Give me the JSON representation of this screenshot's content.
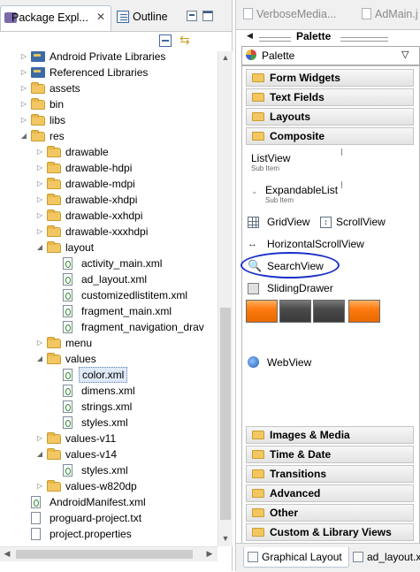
{
  "left_tabs": {
    "package_explorer": "Package Expl...",
    "outline": "Outline"
  },
  "tree": [
    {
      "label": "Android Private Libraries",
      "icon": "library",
      "indent": 0,
      "arrow": "collapsed"
    },
    {
      "label": "Referenced Libraries",
      "icon": "library",
      "indent": 0,
      "arrow": "collapsed"
    },
    {
      "label": "assets",
      "icon": "folder",
      "indent": 0,
      "arrow": "collapsed"
    },
    {
      "label": "bin",
      "icon": "folder",
      "indent": 0,
      "arrow": "collapsed"
    },
    {
      "label": "libs",
      "icon": "folder",
      "indent": 0,
      "arrow": "collapsed"
    },
    {
      "label": "res",
      "icon": "folder",
      "indent": 0,
      "arrow": "expanded"
    },
    {
      "label": "drawable",
      "icon": "folder",
      "indent": 1,
      "arrow": "collapsed"
    },
    {
      "label": "drawable-hdpi",
      "icon": "folder",
      "indent": 1,
      "arrow": "collapsed"
    },
    {
      "label": "drawable-mdpi",
      "icon": "folder",
      "indent": 1,
      "arrow": "collapsed"
    },
    {
      "label": "drawable-xhdpi",
      "icon": "folder",
      "indent": 1,
      "arrow": "collapsed"
    },
    {
      "label": "drawable-xxhdpi",
      "icon": "folder",
      "indent": 1,
      "arrow": "collapsed"
    },
    {
      "label": "drawable-xxxhdpi",
      "icon": "folder",
      "indent": 1,
      "arrow": "collapsed"
    },
    {
      "label": "layout",
      "icon": "folder",
      "indent": 1,
      "arrow": "expanded"
    },
    {
      "label": "activity_main.xml",
      "icon": "xml",
      "indent": 2,
      "arrow": "none"
    },
    {
      "label": "ad_layout.xml",
      "icon": "xml",
      "indent": 2,
      "arrow": "none"
    },
    {
      "label": "customizedlistitem.xml",
      "icon": "xml",
      "indent": 2,
      "arrow": "none"
    },
    {
      "label": "fragment_main.xml",
      "icon": "xml",
      "indent": 2,
      "arrow": "none"
    },
    {
      "label": "fragment_navigation_drav",
      "icon": "xml",
      "indent": 2,
      "arrow": "none"
    },
    {
      "label": "menu",
      "icon": "folder",
      "indent": 1,
      "arrow": "collapsed"
    },
    {
      "label": "values",
      "icon": "folder",
      "indent": 1,
      "arrow": "expanded"
    },
    {
      "label": "color.xml",
      "icon": "xml",
      "indent": 2,
      "arrow": "none",
      "selected": true
    },
    {
      "label": "dimens.xml",
      "icon": "xml",
      "indent": 2,
      "arrow": "none"
    },
    {
      "label": "strings.xml",
      "icon": "xml",
      "indent": 2,
      "arrow": "none"
    },
    {
      "label": "styles.xml",
      "icon": "xml",
      "indent": 2,
      "arrow": "none"
    },
    {
      "label": "values-v11",
      "icon": "folder",
      "indent": 1,
      "arrow": "collapsed"
    },
    {
      "label": "values-v14",
      "icon": "folder",
      "indent": 1,
      "arrow": "expanded"
    },
    {
      "label": "styles.xml",
      "icon": "xml",
      "indent": 2,
      "arrow": "none"
    },
    {
      "label": "values-w820dp",
      "icon": "folder",
      "indent": 1,
      "arrow": "collapsed"
    },
    {
      "label": "AndroidManifest.xml",
      "icon": "xml",
      "indent": 0,
      "arrow": "none"
    },
    {
      "label": "proguard-project.txt",
      "icon": "txt",
      "indent": 0,
      "arrow": "none"
    },
    {
      "label": "project.properties",
      "icon": "txt",
      "indent": 0,
      "arrow": "none"
    }
  ],
  "right_tabs": {
    "tab1": "VerboseMedia...",
    "tab2": "AdMain.j"
  },
  "palette": {
    "title": "Palette",
    "selector": "Palette",
    "categories_top": [
      "Form Widgets",
      "Text Fields",
      "Layouts",
      "Composite"
    ],
    "composite_items": {
      "listview": "ListView",
      "listview_sub": "Sub Item",
      "expandable": "ExpandableList",
      "expandable_sub": "Sub Item",
      "gridview": "GridView",
      "scrollview": "ScrollView",
      "hscroll": "HorizontalScrollView",
      "searchview": "SearchView",
      "sliding": "SlidingDrawer",
      "webview": "WebView"
    },
    "categories_bottom": [
      "Images & Media",
      "Time & Date",
      "Transitions",
      "Advanced",
      "Other",
      "Custom & Library Views"
    ]
  },
  "bottom_tabs": {
    "graphical": "Graphical Layout",
    "adlayout": "ad_layout.x"
  },
  "colors": {
    "annotation_circle": "#1a2fc8",
    "tab_orange": "#ff7a10",
    "tab_gray": "#4a4a4a"
  }
}
